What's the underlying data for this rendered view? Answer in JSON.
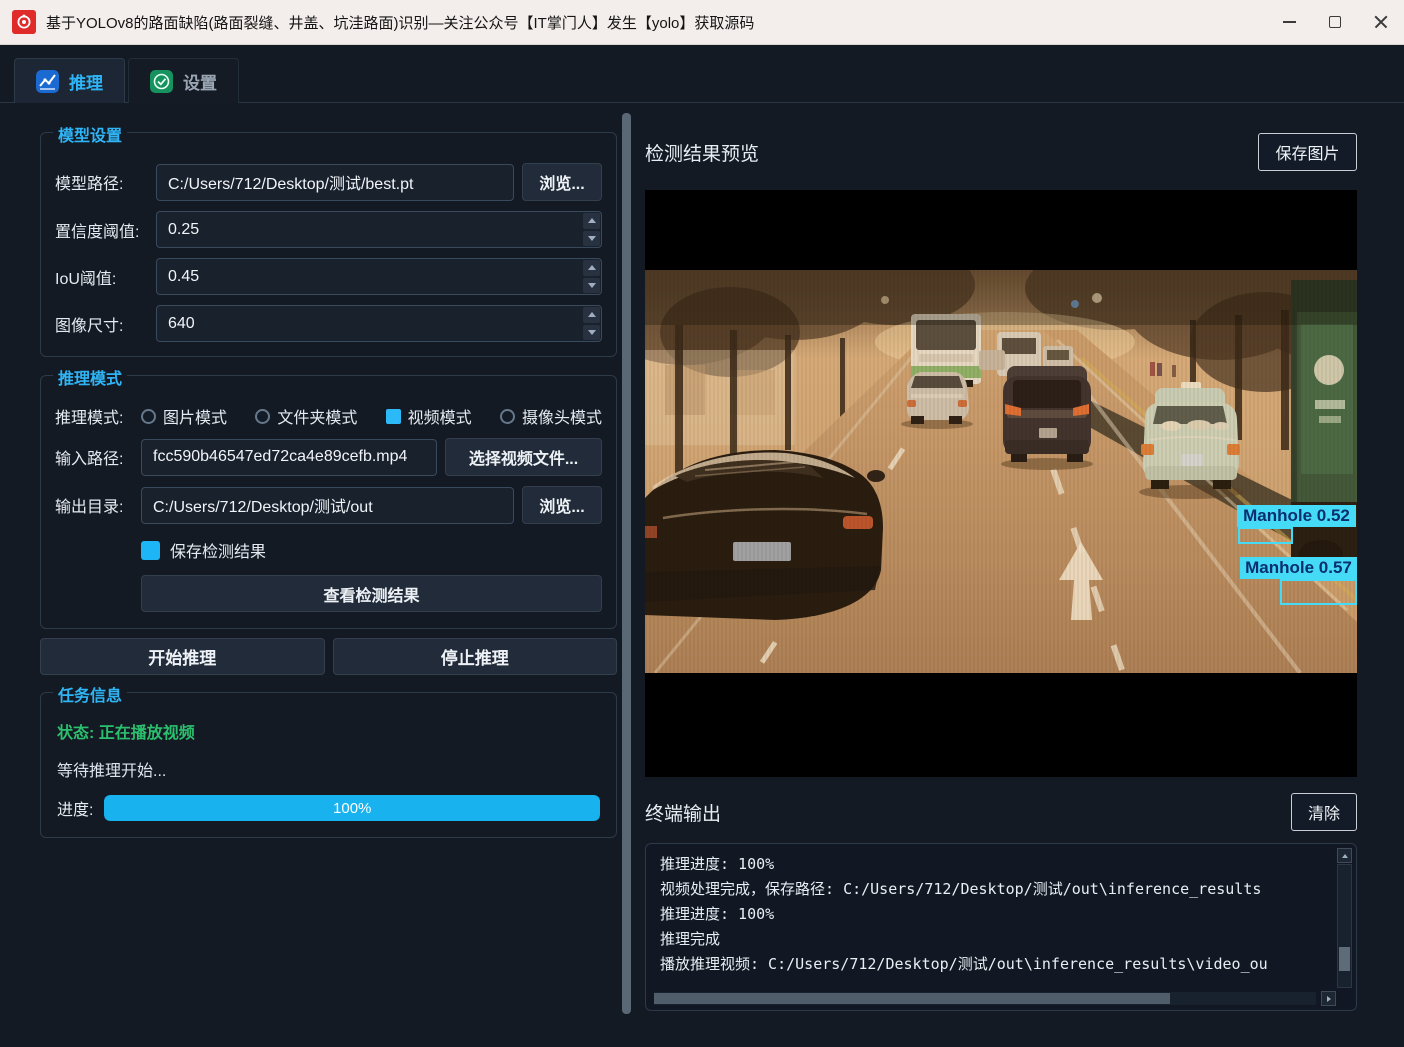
{
  "window": {
    "title": "基于YOLOv8的路面缺陷(路面裂缝、井盖、坑洼路面)识别—关注公众号【IT掌门人】发生【yolo】获取源码"
  },
  "tabs": {
    "inference": "推理",
    "settings": "设置"
  },
  "model_settings": {
    "title": "模型设置",
    "model_path_label": "模型路径:",
    "model_path_value": "C:/Users/712/Desktop/测试/best.pt",
    "browse_label": "浏览...",
    "conf_label": "置信度阈值:",
    "conf_value": "0.25",
    "iou_label": "IoU阈值:",
    "iou_value": "0.45",
    "imgsz_label": "图像尺寸:",
    "imgsz_value": "640"
  },
  "inference_mode": {
    "title": "推理模式",
    "mode_label": "推理模式:",
    "modes": [
      {
        "label": "图片模式",
        "selected": false
      },
      {
        "label": "文件夹模式",
        "selected": false
      },
      {
        "label": "视频模式",
        "selected": true
      },
      {
        "label": "摄像头模式",
        "selected": false
      }
    ],
    "input_path_label": "输入路径:",
    "input_path_value": "fcc590b46547ed72ca4e89cefb.mp4",
    "select_video_label": "选择视频文件...",
    "output_dir_label": "输出目录:",
    "output_dir_value": "C:/Users/712/Desktop/测试/out",
    "browse_label": "浏览...",
    "save_results_label": "保存检测结果",
    "save_results_checked": true,
    "view_results_label": "查看检测结果"
  },
  "actions": {
    "start": "开始推理",
    "stop": "停止推理"
  },
  "task_info": {
    "title": "任务信息",
    "status": "状态: 正在播放视频",
    "message": "等待推理开始...",
    "progress_label": "进度:",
    "progress_text": "100%",
    "progress_percent": 100
  },
  "preview": {
    "title": "检测结果预览",
    "save_button": "保存图片",
    "detections": [
      {
        "label": "Manhole 0.52"
      },
      {
        "label": "Manhole 0.57"
      }
    ]
  },
  "terminal": {
    "title": "终端输出",
    "clear_button": "清除",
    "lines": [
      "推理进度: 100%",
      "视频处理完成，保存路径: C:/Users/712/Desktop/测试/out\\inference_results",
      "推理进度: 100%",
      "推理完成",
      "播放推理视频: C:/Users/712/Desktop/测试/out\\inference_results\\video_ou"
    ]
  },
  "colors": {
    "accent": "#2fb5f6",
    "progress_bar": "#18b2ef",
    "status_green": "#2bbf6e",
    "detection_cyan": "#45dbf7"
  }
}
